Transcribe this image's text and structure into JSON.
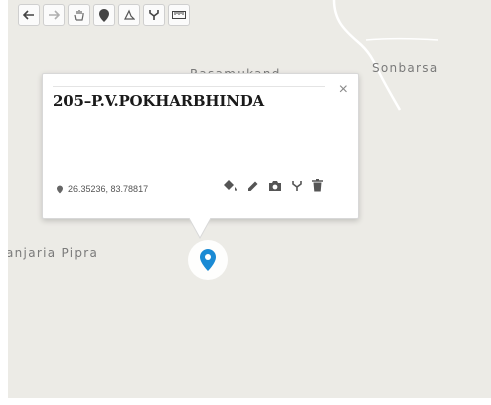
{
  "map": {
    "place_labels": [
      "Sonbarsa",
      "anjaria Pipra",
      "Rasamukand"
    ],
    "colors": {
      "land": "#ecebe6",
      "road": "#ffffff",
      "marker": "#1a8ad4"
    }
  },
  "toolbar": {
    "tools": [
      "undo-icon",
      "redo-icon",
      "pan-hand-icon",
      "marker-icon",
      "draw-polygon-icon",
      "fork-icon",
      "ruler-icon"
    ]
  },
  "popup": {
    "title": "205–P.V.POKHARBHINDA",
    "close_label": "×",
    "coordinates": "26.35236, 83.78817",
    "actions": [
      "paint-bucket-icon",
      "pencil-icon",
      "camera-icon",
      "fork-icon",
      "trash-icon"
    ]
  }
}
